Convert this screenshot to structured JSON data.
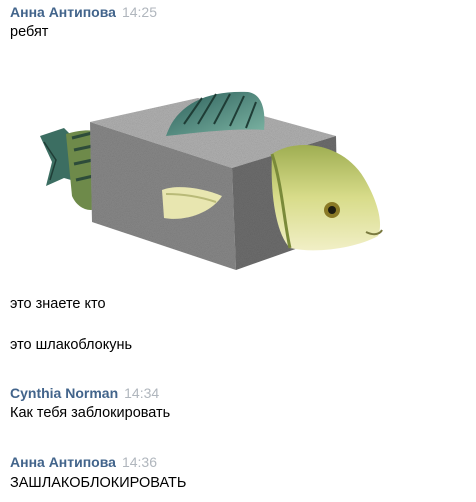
{
  "messages": [
    {
      "author": "Анна Антипова",
      "time": "14:25",
      "lines": [
        "ребят",
        "это знаете кто",
        "это шлакоблокунь"
      ]
    },
    {
      "author": "Cynthia Norman",
      "time": "14:34",
      "lines": [
        "Как тебя заблокировать"
      ]
    },
    {
      "author": "Анна Антипова",
      "time": "14:36",
      "lines": [
        "ЗАШЛАКОБЛОКИРОВАТЬ"
      ]
    }
  ],
  "colors": {
    "author": "#42648b",
    "time": "#b0b6bd",
    "text": "#000000"
  }
}
